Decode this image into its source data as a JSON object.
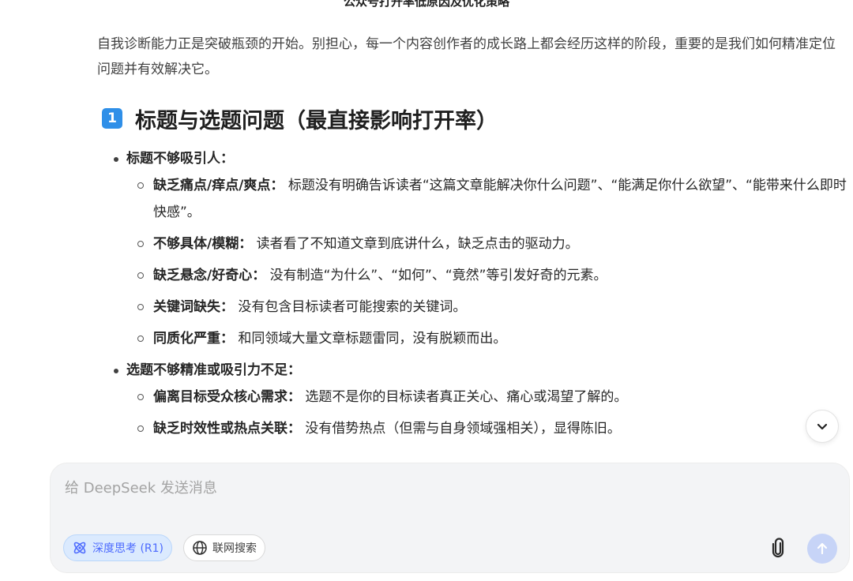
{
  "header": {
    "title": "公众号打开率低原因及优化策略"
  },
  "article": {
    "intro": "自我诊断能力正是突破瓶颈的开始。别担心，每一个内容创作者的成长路上都会经历这样的阶段，重要的是我们如何精准定位问题并有效解决它。",
    "section": {
      "number": "1",
      "title": "标题与选题问题（最直接影响打开率）",
      "groups": [
        {
          "label": "标题不够吸引人：",
          "items": [
            {
              "term": "缺乏痛点/痒点/爽点：",
              "desc": "标题没有明确告诉读者“这篇文章能解决你什么问题”、“能满足你什么欲望”、“能带来什么即时快感”。"
            },
            {
              "term": "不够具体/模糊：",
              "desc": "读者看了不知道文章到底讲什么，缺乏点击的驱动力。"
            },
            {
              "term": "缺乏悬念/好奇心：",
              "desc": "没有制造“为什么”、“如何”、“竟然”等引发好奇的元素。"
            },
            {
              "term": "关键词缺失：",
              "desc": "没有包含目标读者可能搜索的关键词。"
            },
            {
              "term": "同质化严重：",
              "desc": "和同领域大量文章标题雷同，没有脱颖而出。"
            }
          ]
        },
        {
          "label": "选题不够精准或吸引力不足：",
          "items": [
            {
              "term": "偏离目标受众核心需求：",
              "desc": "选题不是你的目标读者真正关心、痛心或渴望了解的。"
            },
            {
              "term": "缺乏时效性或热点关联：",
              "desc": "没有借势热点（但需与自身领域强相关），显得陈旧。"
            }
          ]
        }
      ]
    }
  },
  "composer": {
    "placeholder": "给 DeepSeek 发送消息",
    "value": "",
    "deep_think_label": "深度思考 (R1)",
    "web_search_label": "联网搜索"
  },
  "icons": {
    "scroll": "chevron-down-icon",
    "deep_think": "atom-icon",
    "web_search": "globe-icon",
    "attach": "paperclip-icon",
    "send": "arrow-up-icon"
  },
  "colors": {
    "accent": "#4d6bfe",
    "badge": "#2f8fe8",
    "send_disabled": "#c7d4f7"
  }
}
